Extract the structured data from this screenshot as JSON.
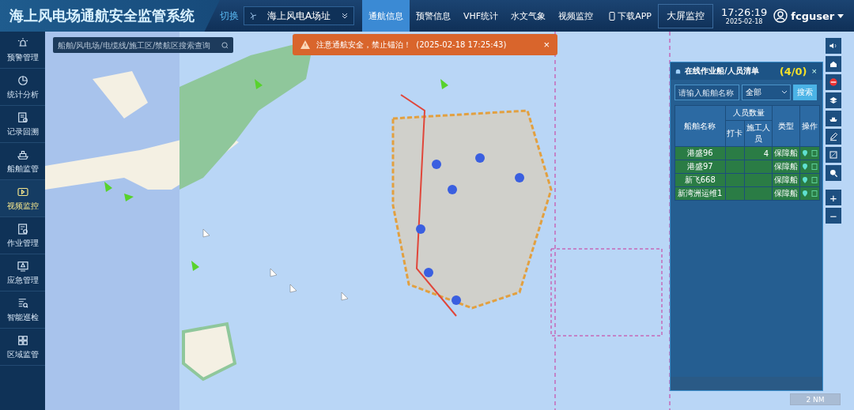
{
  "header": {
    "title": "海上风电场通航安全监管系统",
    "switch_label": "切换",
    "site_select": {
      "value": "海上风电A场址"
    },
    "tabs": [
      {
        "label": "通航信息",
        "selected": true
      },
      {
        "label": "预警信息",
        "selected": false
      },
      {
        "label": "VHF统计",
        "selected": false
      },
      {
        "label": "水文气象",
        "selected": false
      },
      {
        "label": "视频监控",
        "selected": false
      }
    ],
    "download": "下载APP",
    "big_screen": "大屏监控",
    "time": "17:26:19",
    "date": "2025-02-18",
    "user": "fcguser"
  },
  "sidebar": {
    "items": [
      {
        "label": "预警管理",
        "selected": false
      },
      {
        "label": "统计分析",
        "selected": false
      },
      {
        "label": "记录回溯",
        "selected": false
      },
      {
        "label": "船舶监管",
        "selected": false
      },
      {
        "label": "视频监控",
        "selected": true
      },
      {
        "label": "作业管理",
        "selected": false
      },
      {
        "label": "应急管理",
        "selected": false
      },
      {
        "label": "智能巡检",
        "selected": false
      },
      {
        "label": "区域监管",
        "selected": false
      }
    ]
  },
  "map": {
    "search": {
      "placeholder": "船舶/风电场/电缆线/施工区/禁航区搜索查询"
    },
    "alert": {
      "message": "注意通航安全，禁止锚泊！",
      "time": "(2025-02-18 17:25:43)",
      "close": "×"
    },
    "scale": "2 NM",
    "tools": [
      {
        "label": "+"
      },
      {
        "label": "−"
      }
    ]
  },
  "panel": {
    "title": "在线作业船/人员清单",
    "count": "(4/0)",
    "close": "×",
    "search": {
      "placeholder": "请输入船舶名称"
    },
    "filter": {
      "value": "全部"
    },
    "search_button": "搜索",
    "columns": {
      "name": "船舶名称",
      "group": "人员数量",
      "checkin": "打卡",
      "workers": "施工人员",
      "type": "类型",
      "action": "操作"
    },
    "rows": [
      {
        "name": "港盛96",
        "workers": "4",
        "type": "保障船"
      },
      {
        "name": "港盛97",
        "type": "保障船"
      },
      {
        "name": "新飞668",
        "type": "保障船"
      },
      {
        "name": "新湾洲运维1",
        "type": "保障船"
      }
    ]
  }
}
